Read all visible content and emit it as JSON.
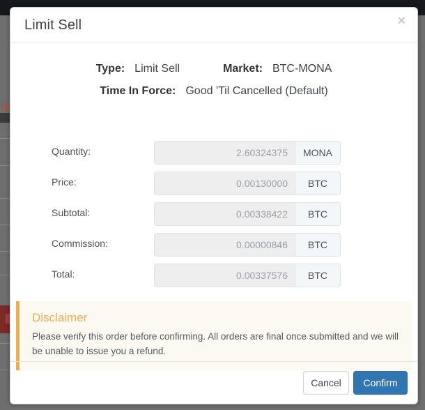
{
  "modal": {
    "title": "Limit Sell",
    "close_icon": "close-icon",
    "close_label": "×",
    "summary": [
      {
        "label": "Type:",
        "value": "Limit Sell"
      },
      {
        "label": "Market:",
        "value": "BTC-MONA"
      },
      {
        "label": "Time In Force:",
        "value": "Good 'Til Cancelled (Default)"
      }
    ],
    "fields": [
      {
        "label": "Quantity:",
        "value": "2.60324375",
        "unit": "MONA"
      },
      {
        "label": "Price:",
        "value": "0.00130000",
        "unit": "BTC"
      },
      {
        "label": "Subtotal:",
        "value": "0.00338422",
        "unit": "BTC"
      },
      {
        "label": "Commission:",
        "value": "0.00000846",
        "unit": "BTC"
      },
      {
        "label": "Total:",
        "value": "0.00337576",
        "unit": "BTC"
      }
    ],
    "disclaimer": {
      "title": "Disclaimer",
      "text": "Please verify this order before confirming. All orders are final once submitted and we will be unable to issue you a refund."
    },
    "footer": {
      "cancel_label": "Cancel",
      "confirm_label": "Confirm"
    }
  },
  "colors": {
    "accent_blue": "#3276b1",
    "warning_orange": "#f0ad4e",
    "disclaimer_bg": "#fcf9f2",
    "input_bg": "#eeeeee",
    "addon_bg": "#f4f7fa",
    "navbar_dark": "#15191d",
    "backdrop_gray": "#6e6e6e"
  }
}
